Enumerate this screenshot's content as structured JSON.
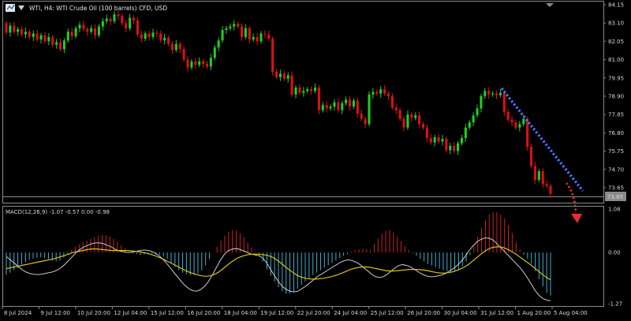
{
  "window": {
    "symbol_title": "WTI, H4:  WTI Crude Oil (100 barrels) CFD, USD",
    "icon": "chart-window-icon",
    "collapse_icon": "triangle-down-icon"
  },
  "colors": {
    "background": "#000000",
    "bull": "#20d020",
    "bear": "#e01010",
    "grid": "#8a8a8a",
    "text": "#d8d8d8",
    "macd_hist_positive": "#cc2222",
    "macd_hist_negative": "#3fb0d0",
    "macd_main": "#e0e0e0",
    "macd_signal": "#d8c020",
    "trend_blue": "#4a6cf0",
    "trend_red": "#e03030"
  },
  "current_price_label": "73.65",
  "chart_data": [
    {
      "type": "candlestick",
      "yticks": [
        "84.15",
        "83.10",
        "82.05",
        "81.00",
        "79.95",
        "78.90",
        "77.85",
        "76.80",
        "75.75",
        "74.70",
        "73.65"
      ],
      "ylim": [
        73.1,
        84.2
      ],
      "xticks": [
        "8 Jul 2024",
        "9 Jul 12:00",
        "10 Jul 20:00",
        "12 Jul 04:00",
        "15 Jul 12:00",
        "16 Jul 20:00",
        "18 Jul 04:00",
        "19 Jul 12:00",
        "22 Jul 20:00",
        "24 Jul 04:00",
        "25 Jul 12:00",
        "26 Jul 20:00",
        "30 Jul 04:00",
        "31 Jul 12:00",
        "1 Aug 20:00",
        "5 Aug 04:00"
      ],
      "candles": [
        [
          83.1,
          82.55
        ],
        [
          82.55,
          82.95
        ],
        [
          82.95,
          82.6
        ],
        [
          82.6,
          82.75
        ],
        [
          82.75,
          82.45
        ],
        [
          82.45,
          82.6
        ],
        [
          82.6,
          82.3
        ],
        [
          82.3,
          82.5
        ],
        [
          82.5,
          82.15
        ],
        [
          82.15,
          82.4
        ],
        [
          82.4,
          82.05
        ],
        [
          82.05,
          82.3
        ],
        [
          82.3,
          81.85
        ],
        [
          81.85,
          82.0
        ],
        [
          82.0,
          81.6
        ],
        [
          81.6,
          82.1
        ],
        [
          82.1,
          82.6
        ],
        [
          82.6,
          82.35
        ],
        [
          82.35,
          82.8
        ],
        [
          82.8,
          83.0
        ],
        [
          83.0,
          82.75
        ],
        [
          82.75,
          82.6
        ],
        [
          82.6,
          82.8
        ],
        [
          82.8,
          82.4
        ],
        [
          82.4,
          82.9
        ],
        [
          82.9,
          83.2
        ],
        [
          83.2,
          83.35
        ],
        [
          83.35,
          83.2
        ],
        [
          83.2,
          83.6
        ],
        [
          83.6,
          83.5
        ],
        [
          83.5,
          83.1
        ],
        [
          83.1,
          82.8
        ],
        [
          82.8,
          83.4
        ],
        [
          83.4,
          83.25
        ],
        [
          83.25,
          82.45
        ],
        [
          82.45,
          82.2
        ],
        [
          82.2,
          82.5
        ],
        [
          82.5,
          82.3
        ],
        [
          82.3,
          82.55
        ],
        [
          82.55,
          82.5
        ],
        [
          82.5,
          82.1
        ],
        [
          82.1,
          82.25
        ],
        [
          82.25,
          81.9
        ],
        [
          81.9,
          81.55
        ],
        [
          81.55,
          81.9
        ],
        [
          81.9,
          81.6
        ],
        [
          81.6,
          81.0
        ],
        [
          81.0,
          80.55
        ],
        [
          80.55,
          80.9
        ],
        [
          80.9,
          80.7
        ],
        [
          80.7,
          80.9
        ],
        [
          80.9,
          80.75
        ],
        [
          80.75,
          80.6
        ],
        [
          80.6,
          81.1
        ],
        [
          81.1,
          81.7
        ],
        [
          81.7,
          82.1
        ],
        [
          82.1,
          82.7
        ],
        [
          82.7,
          82.8
        ],
        [
          82.8,
          82.9
        ],
        [
          82.9,
          83.05
        ],
        [
          83.05,
          82.9
        ],
        [
          82.9,
          82.3
        ],
        [
          82.3,
          82.8
        ],
        [
          82.8,
          82.15
        ],
        [
          82.15,
          82.3
        ],
        [
          82.3,
          82.05
        ],
        [
          82.05,
          82.5
        ],
        [
          82.5,
          82.45
        ],
        [
          82.45,
          82.2
        ],
        [
          82.2,
          80.3
        ],
        [
          80.3,
          80.0
        ],
        [
          80.0,
          80.2
        ],
        [
          80.2,
          79.9
        ],
        [
          79.9,
          80.1
        ],
        [
          80.1,
          79.0
        ],
        [
          79.0,
          79.4
        ],
        [
          79.4,
          79.1
        ],
        [
          79.1,
          79.2
        ],
        [
          79.2,
          79.3
        ],
        [
          79.3,
          79.2
        ],
        [
          79.2,
          79.4
        ],
        [
          79.4,
          78.1
        ],
        [
          78.1,
          78.4
        ],
        [
          78.4,
          78.2
        ],
        [
          78.2,
          78.3
        ],
        [
          78.3,
          78.55
        ],
        [
          78.55,
          78.1
        ],
        [
          78.1,
          78.5
        ],
        [
          78.5,
          78.7
        ],
        [
          78.7,
          78.3
        ],
        [
          78.3,
          78.65
        ],
        [
          78.65,
          77.9
        ],
        [
          77.9,
          77.6
        ],
        [
          77.6,
          77.3
        ],
        [
          77.3,
          79.0
        ],
        [
          79.0,
          79.15
        ],
        [
          79.15,
          79.05
        ],
        [
          79.05,
          79.3
        ],
        [
          79.3,
          79.05
        ],
        [
          79.05,
          78.9
        ],
        [
          78.9,
          78.25
        ],
        [
          78.25,
          78.1
        ],
        [
          78.1,
          77.6
        ],
        [
          77.6,
          77.1
        ],
        [
          77.1,
          77.85
        ],
        [
          77.85,
          77.65
        ],
        [
          77.65,
          77.8
        ],
        [
          77.8,
          77.3
        ],
        [
          77.3,
          77.1
        ],
        [
          77.1,
          76.5
        ],
        [
          76.5,
          76.25
        ],
        [
          76.25,
          76.55
        ],
        [
          76.55,
          76.3
        ],
        [
          76.3,
          76.45
        ],
        [
          76.45,
          75.8
        ],
        [
          75.8,
          76.05
        ],
        [
          76.05,
          75.75
        ],
        [
          75.75,
          76.2
        ],
        [
          76.2,
          76.5
        ],
        [
          76.5,
          77.1
        ],
        [
          77.1,
          77.4
        ],
        [
          77.4,
          77.8
        ],
        [
          77.8,
          78.2
        ],
        [
          78.2,
          78.9
        ],
        [
          78.9,
          79.2
        ],
        [
          79.2,
          79.0
        ],
        [
          79.0,
          79.05
        ],
        [
          79.05,
          78.95
        ],
        [
          78.95,
          79.1
        ],
        [
          79.1,
          78.0
        ],
        [
          78.0,
          77.55
        ],
        [
          77.55,
          77.4
        ],
        [
          77.4,
          77.1
        ],
        [
          77.1,
          77.3
        ],
        [
          77.3,
          77.6
        ],
        [
          77.6,
          76.0
        ],
        [
          76.0,
          74.9
        ],
        [
          74.9,
          74.1
        ],
        [
          74.1,
          74.6
        ],
        [
          74.6,
          73.85
        ],
        [
          73.85,
          73.75
        ],
        [
          73.75,
          73.3
        ]
      ]
    },
    {
      "type": "bar",
      "title": "MACD(12,26,9) -1.07 -0.57 0.00 -0.98",
      "yticks": [
        "1.08",
        "0.00",
        "-1.27"
      ],
      "ylim": [
        -1.27,
        1.08
      ],
      "series": [
        {
          "type": "bar",
          "values": [
            -0.55,
            -0.5,
            -0.44,
            -0.38,
            -0.3,
            -0.24,
            -0.18,
            -0.15,
            -0.13,
            -0.12,
            -0.13,
            -0.16,
            -0.2,
            -0.22,
            -0.2,
            -0.12,
            -0.04,
            0.06,
            0.14,
            0.2,
            0.26,
            0.3,
            0.34,
            0.38,
            0.42,
            0.44,
            0.43,
            0.4,
            0.34,
            0.26,
            0.18,
            0.1,
            0.02,
            -0.02,
            -0.04,
            -0.06,
            -0.05,
            -0.04,
            -0.03,
            -0.04,
            -0.06,
            -0.1,
            -0.16,
            -0.26,
            -0.36,
            -0.44,
            -0.5,
            -0.54,
            -0.56,
            -0.56,
            -0.52,
            -0.44,
            -0.32,
            -0.16,
            0.0,
            0.14,
            0.3,
            0.42,
            0.52,
            0.56,
            0.54,
            0.48,
            0.38,
            0.24,
            0.12,
            0.02,
            -0.04,
            -0.22,
            -0.42,
            -0.58,
            -0.72,
            -0.86,
            -0.96,
            -1.02,
            -1.02,
            -0.98,
            -0.9,
            -0.8,
            -0.72,
            -0.64,
            -0.56,
            -0.5,
            -0.44,
            -0.38,
            -0.32,
            -0.26,
            -0.2,
            -0.14,
            -0.08,
            -0.04,
            0.02,
            0.06,
            0.08,
            0.09,
            0.08,
            0.06,
            0.2,
            0.34,
            0.46,
            0.54,
            0.56,
            0.5,
            0.4,
            0.28,
            0.16,
            0.06,
            -0.02,
            -0.08,
            -0.16,
            -0.22,
            -0.28,
            -0.32,
            -0.36,
            -0.4,
            -0.44,
            -0.46,
            -0.48,
            -0.46,
            -0.42,
            -0.34,
            -0.22,
            -0.06,
            0.16,
            0.4,
            0.62,
            0.8,
            0.94,
            1.0,
            1.0,
            0.94,
            0.84,
            0.68,
            0.48,
            0.26,
            0.08,
            -0.06,
            -0.16,
            -0.28,
            -0.46,
            -0.66,
            -0.84,
            -1.0,
            -1.07
          ]
        },
        {
          "type": "line",
          "name": "main",
          "values": [
            -0.1,
            -0.18,
            -0.26,
            -0.34,
            -0.42,
            -0.48,
            -0.52,
            -0.54,
            -0.55,
            -0.54,
            -0.52,
            -0.5,
            -0.48,
            -0.44,
            -0.38,
            -0.3,
            -0.2,
            -0.1,
            0.0,
            0.08,
            0.14,
            0.18,
            0.22,
            0.24,
            0.24,
            0.22,
            0.18,
            0.14,
            0.08,
            0.04,
            0.02,
            0.0,
            0.0,
            0.02,
            0.04,
            0.06,
            0.06,
            0.04,
            0.0,
            -0.06,
            -0.14,
            -0.24,
            -0.36,
            -0.48,
            -0.6,
            -0.72,
            -0.82,
            -0.9,
            -0.95,
            -0.96,
            -0.92,
            -0.84,
            -0.72,
            -0.56,
            -0.38,
            -0.2,
            -0.06,
            0.04,
            0.08,
            0.1,
            0.08,
            0.04,
            0.0,
            -0.04,
            -0.06,
            -0.08,
            -0.14,
            -0.26,
            -0.42,
            -0.58,
            -0.72,
            -0.84,
            -0.92,
            -0.96,
            -0.98,
            -0.96,
            -0.9,
            -0.84,
            -0.76,
            -0.68,
            -0.6,
            -0.54,
            -0.48,
            -0.42,
            -0.36,
            -0.3,
            -0.24,
            -0.2,
            -0.18,
            -0.2,
            -0.24,
            -0.3,
            -0.38,
            -0.46,
            -0.54,
            -0.6,
            -0.62,
            -0.6,
            -0.54,
            -0.46,
            -0.38,
            -0.32,
            -0.3,
            -0.32,
            -0.36,
            -0.42,
            -0.48,
            -0.54,
            -0.58,
            -0.6,
            -0.6,
            -0.58,
            -0.56,
            -0.52,
            -0.46,
            -0.4,
            -0.32,
            -0.22,
            -0.1,
            0.04,
            0.16,
            0.26,
            0.32,
            0.36,
            0.36,
            0.32,
            0.24,
            0.14,
            0.04,
            -0.06,
            -0.16,
            -0.26,
            -0.36,
            -0.48,
            -0.62,
            -0.78,
            -0.94,
            -1.06,
            -1.14,
            -1.18,
            -1.2
          ]
        },
        {
          "type": "line",
          "name": "signal",
          "values": [
            -0.4,
            -0.38,
            -0.36,
            -0.34,
            -0.32,
            -0.3,
            -0.28,
            -0.26,
            -0.24,
            -0.22,
            -0.2,
            -0.18,
            -0.16,
            -0.13,
            -0.1,
            -0.07,
            -0.04,
            0.0,
            0.02,
            0.04,
            0.06,
            0.08,
            0.09,
            0.09,
            0.08,
            0.07,
            0.06,
            0.05,
            0.05,
            0.05,
            0.05,
            0.05,
            0.04,
            0.03,
            0.02,
            0.0,
            -0.02,
            -0.05,
            -0.08,
            -0.12,
            -0.16,
            -0.21,
            -0.26,
            -0.31,
            -0.36,
            -0.41,
            -0.46,
            -0.5,
            -0.53,
            -0.56,
            -0.58,
            -0.59,
            -0.58,
            -0.55,
            -0.5,
            -0.43,
            -0.35,
            -0.27,
            -0.2,
            -0.14,
            -0.1,
            -0.07,
            -0.05,
            -0.04,
            -0.04,
            -0.05,
            -0.06,
            -0.08,
            -0.12,
            -0.18,
            -0.25,
            -0.33,
            -0.41,
            -0.48,
            -0.55,
            -0.6,
            -0.63,
            -0.65,
            -0.66,
            -0.66,
            -0.65,
            -0.64,
            -0.62,
            -0.6,
            -0.57,
            -0.54,
            -0.5,
            -0.46,
            -0.42,
            -0.39,
            -0.37,
            -0.36,
            -0.36,
            -0.37,
            -0.39,
            -0.41,
            -0.43,
            -0.45,
            -0.46,
            -0.46,
            -0.45,
            -0.44,
            -0.43,
            -0.42,
            -0.42,
            -0.42,
            -0.43,
            -0.44,
            -0.46,
            -0.48,
            -0.5,
            -0.51,
            -0.51,
            -0.5,
            -0.48,
            -0.45,
            -0.41,
            -0.36,
            -0.3,
            -0.22,
            -0.14,
            -0.06,
            0.02,
            0.08,
            0.12,
            0.14,
            0.14,
            0.12,
            0.08,
            0.03,
            -0.03,
            -0.1,
            -0.17,
            -0.24,
            -0.31,
            -0.39,
            -0.47,
            -0.55,
            -0.62,
            -0.68
          ]
        }
      ]
    }
  ]
}
